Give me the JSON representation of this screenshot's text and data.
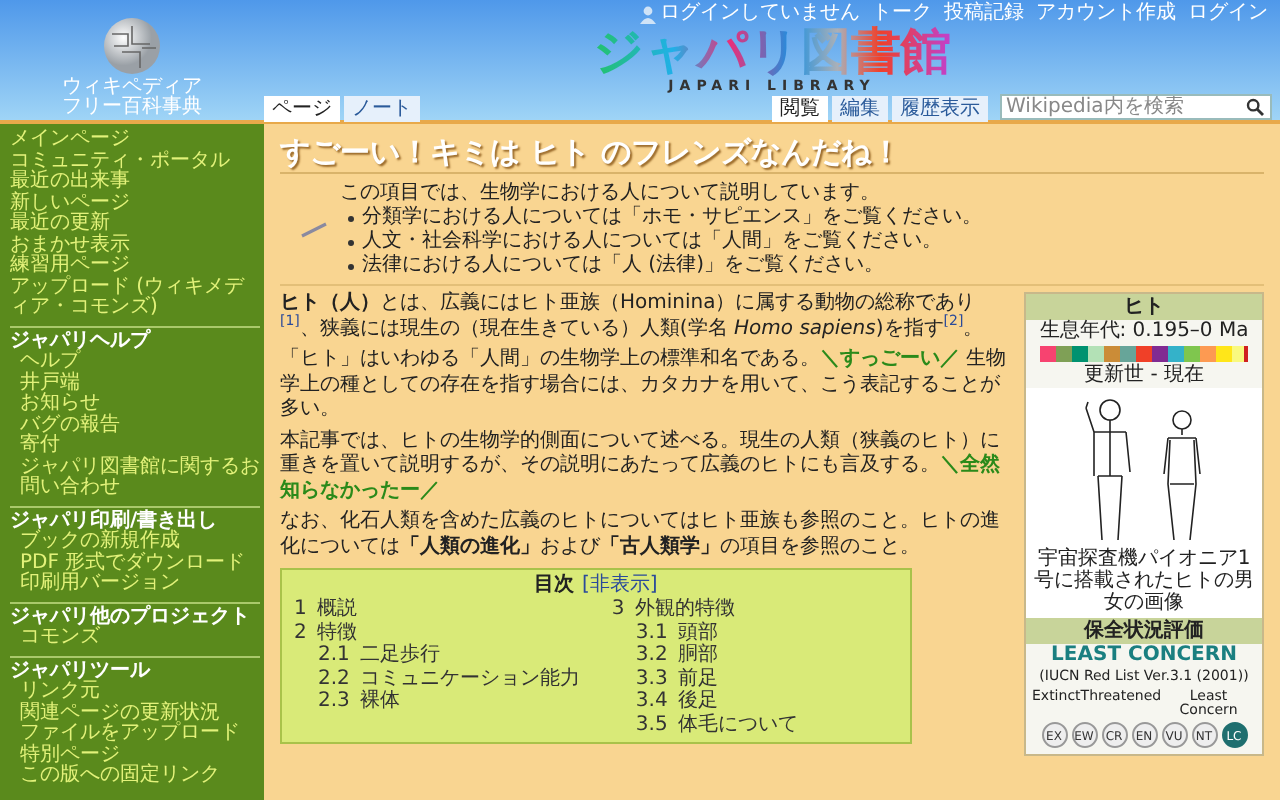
{
  "header": {
    "logo_title": "ウィキペディア",
    "logo_subtitle": "フリー百科事典",
    "site_title": "ジャパリ図書館",
    "site_subtitle": "JAPARI LIBRARY",
    "personal_links": [
      {
        "text": "ログインしていません",
        "kind": "status"
      },
      {
        "text": "トーク",
        "kind": "link"
      },
      {
        "text": "投稿記録",
        "kind": "link"
      },
      {
        "text": "アカウント作成",
        "kind": "link"
      },
      {
        "text": "ログイン",
        "kind": "link"
      }
    ]
  },
  "tabs_left": [
    {
      "label": "ページ",
      "selected": true
    },
    {
      "label": "ノート",
      "selected": false
    }
  ],
  "tabs_right": [
    {
      "label": "閲覧",
      "selected": true
    },
    {
      "label": "編集",
      "selected": false
    },
    {
      "label": "履歴表示",
      "selected": false
    }
  ],
  "search": {
    "placeholder": "Wikipedia内を検索"
  },
  "sidebar": {
    "groups": [
      {
        "items": [
          "メインページ",
          "コミュニティ・ポータル",
          "最近の出来事",
          "新しいページ",
          "最近の更新",
          "おまかせ表示",
          "練習用ページ",
          "アップロード (ウィキメディア・コモンズ)"
        ]
      },
      {
        "heading": "ジャパリヘルプ",
        "items": [
          "ヘルプ",
          "井戸端",
          "お知らせ",
          "バグの報告",
          "寄付",
          "ジャパリ図書館に関するお問い合わせ"
        ]
      },
      {
        "heading": "ジャパリ印刷/書き出し",
        "items": [
          "ブックの新規作成",
          "PDF 形式でダウンロード",
          "印刷用バージョン"
        ]
      },
      {
        "heading": "ジャパリ他のプロジェクト",
        "items": [
          "コモンズ"
        ]
      },
      {
        "heading": "ジャパリツール",
        "items": [
          "リンク元",
          "関連ページの更新状況",
          "ファイルをアップロード",
          "特別ページ",
          "この版への固定リンク"
        ]
      }
    ]
  },
  "article": {
    "title": "すごーい！キミは ヒト のフレンズなんだね！",
    "hatnote": {
      "intro": "この項目では、生物学における人について説明しています。",
      "items": [
        "分類学における人については「ホモ・サピエンス」をご覧ください。",
        "人文・社会科学における人については「人間」をご覧ください。",
        "法律における人については「人 (法律)」をご覧ください。"
      ]
    },
    "paragraphs": [
      [
        {
          "t": "ヒト（人）",
          "kind": "bold"
        },
        {
          "t": "とは、広義にはヒト亜族（Hominina）に属する動物の総称であり",
          "kind": "plain"
        },
        {
          "t": "[1]",
          "kind": "ref"
        },
        {
          "t": "、狭義には現生の（現在生きている）人類(学名 ",
          "kind": "plain"
        },
        {
          "t": "Homo sapiens",
          "kind": "italic"
        },
        {
          "t": ")を指す",
          "kind": "plain"
        },
        {
          "t": "[2]",
          "kind": "ref"
        },
        {
          "t": "。",
          "kind": "plain"
        }
      ],
      [
        {
          "t": "「ヒト」はいわゆる「人間」の生物学上の標準和名である。",
          "kind": "plain"
        },
        {
          "t": "＼すっごーい／",
          "kind": "cheer"
        },
        {
          "t": " 生物学上の種としての存在を指す場合には、カタカナを用いて、こう表記することが多い。",
          "kind": "plain"
        }
      ],
      [
        {
          "t": "本記事では、ヒトの生物学的側面について述べる。現生の人類（狭義のヒト）に重きを置いて説明するが、その説明にあたって広義のヒトにも言及する。",
          "kind": "plain"
        },
        {
          "t": "＼全然知らなかったー／",
          "kind": "cheer"
        }
      ],
      [
        {
          "t": "なお、化石人類を含めた広義のヒトについてはヒト亜族も参照のこと。ヒトの進化については",
          "kind": "plain"
        },
        {
          "t": "「人類の進化」",
          "kind": "bold"
        },
        {
          "t": "および",
          "kind": "plain"
        },
        {
          "t": "「古人類学」",
          "kind": "bold"
        },
        {
          "t": "の項目を参照のこと。",
          "kind": "plain"
        }
      ]
    ],
    "toc": {
      "title": "目次",
      "toggle": "[非表示]",
      "items": [
        {
          "number": "1",
          "title": "概説"
        },
        {
          "number": "2",
          "title": "特徴",
          "children": [
            {
              "number": "2.1",
              "title": "二足歩行"
            },
            {
              "number": "2.2",
              "title": "コミュニケーション能力"
            },
            {
              "number": "2.3",
              "title": "裸体"
            }
          ]
        },
        {
          "number": "3",
          "title": "外観的特徴",
          "children": [
            {
              "number": "3.1",
              "title": "頭部"
            },
            {
              "number": "3.2",
              "title": "胴部"
            },
            {
              "number": "3.3",
              "title": "前足"
            },
            {
              "number": "3.4",
              "title": "後足"
            },
            {
              "number": "3.5",
              "title": "体毛について"
            }
          ]
        }
      ]
    }
  },
  "infobox": {
    "title": "ヒト",
    "era": "生息年代: 0.195–0 Ma",
    "period": "更新世 - 現在",
    "image_caption": "宇宙探査機パイオニア1号に搭載されたヒトの男女の画像",
    "status_heading": "保全状況評価",
    "status": "LEAST CONCERN",
    "source": "(IUCN Red List Ver.3.1 (2001))",
    "scale_labels": [
      "Extinct",
      "Threatened",
      "Least Concern"
    ],
    "scale": [
      {
        "code": "EX",
        "selected": false
      },
      {
        "code": "EW",
        "selected": false
      },
      {
        "code": "CR",
        "selected": false
      },
      {
        "code": "EN",
        "selected": false
      },
      {
        "code": "VU",
        "selected": false
      },
      {
        "code": "NT",
        "selected": false
      },
      {
        "code": "LC",
        "selected": true
      }
    ]
  }
}
